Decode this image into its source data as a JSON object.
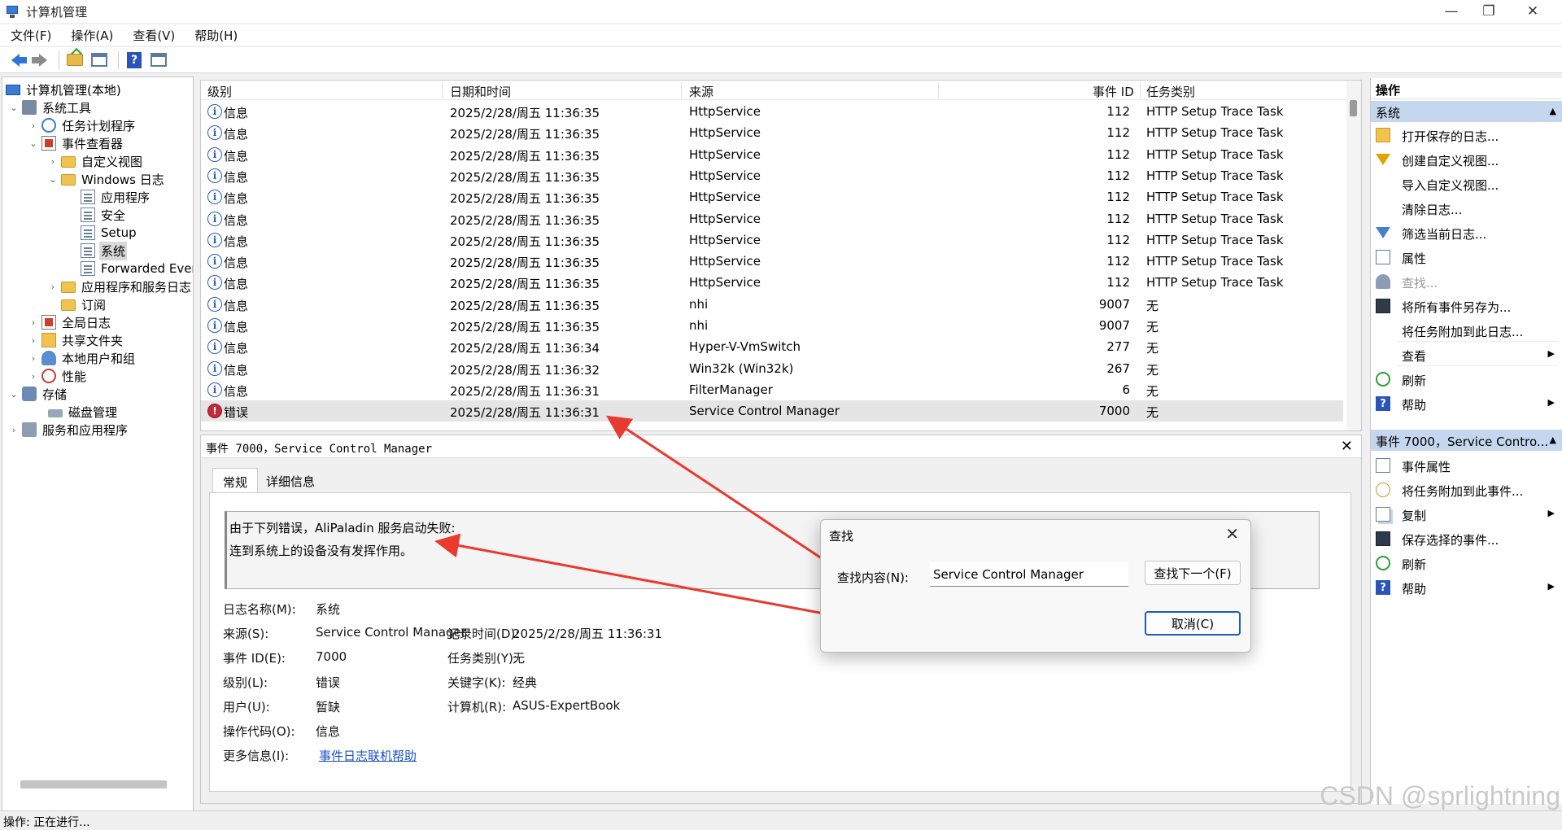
{
  "window": {
    "title": "计算机管理",
    "minimize": "—",
    "maximize": "❐",
    "close": "✕"
  },
  "menu": [
    "文件(F)",
    "操作(A)",
    "查看(V)",
    "帮助(H)"
  ],
  "tree": {
    "root": "计算机管理(本地)",
    "system_tools": "系统工具",
    "task_scheduler": "任务计划程序",
    "event_viewer": "事件查看器",
    "custom_views": "自定义视图",
    "windows_logs": "Windows 日志",
    "application": "应用程序",
    "security": "安全",
    "setup": "Setup",
    "system": "系统",
    "forwarded": "Forwarded Even",
    "app_service_logs": "应用程序和服务日志",
    "subscriptions": "订阅",
    "global_logs": "全局日志",
    "shared_folders": "共享文件夹",
    "local_users": "本地用户和组",
    "performance": "性能",
    "storage": "存储",
    "disk_mgmt": "磁盘管理",
    "services_apps": "服务和应用程序"
  },
  "events": {
    "columns": {
      "level": "级别",
      "datetime": "日期和时间",
      "source": "来源",
      "event_id": "事件 ID",
      "category": "任务类别"
    },
    "rows": [
      {
        "level": "信息",
        "datetime": "2025/2/28/周五 11:36:35",
        "source": "HttpService",
        "id": "112",
        "category": "HTTP Setup Trace Task"
      },
      {
        "level": "信息",
        "datetime": "2025/2/28/周五 11:36:35",
        "source": "HttpService",
        "id": "112",
        "category": "HTTP Setup Trace Task"
      },
      {
        "level": "信息",
        "datetime": "2025/2/28/周五 11:36:35",
        "source": "HttpService",
        "id": "112",
        "category": "HTTP Setup Trace Task"
      },
      {
        "level": "信息",
        "datetime": "2025/2/28/周五 11:36:35",
        "source": "HttpService",
        "id": "112",
        "category": "HTTP Setup Trace Task"
      },
      {
        "level": "信息",
        "datetime": "2025/2/28/周五 11:36:35",
        "source": "HttpService",
        "id": "112",
        "category": "HTTP Setup Trace Task"
      },
      {
        "level": "信息",
        "datetime": "2025/2/28/周五 11:36:35",
        "source": "HttpService",
        "id": "112",
        "category": "HTTP Setup Trace Task"
      },
      {
        "level": "信息",
        "datetime": "2025/2/28/周五 11:36:35",
        "source": "HttpService",
        "id": "112",
        "category": "HTTP Setup Trace Task"
      },
      {
        "level": "信息",
        "datetime": "2025/2/28/周五 11:36:35",
        "source": "HttpService",
        "id": "112",
        "category": "HTTP Setup Trace Task"
      },
      {
        "level": "信息",
        "datetime": "2025/2/28/周五 11:36:35",
        "source": "HttpService",
        "id": "112",
        "category": "HTTP Setup Trace Task"
      },
      {
        "level": "信息",
        "datetime": "2025/2/28/周五 11:36:35",
        "source": "nhi",
        "id": "9007",
        "category": "无"
      },
      {
        "level": "信息",
        "datetime": "2025/2/28/周五 11:36:35",
        "source": "nhi",
        "id": "9007",
        "category": "无"
      },
      {
        "level": "信息",
        "datetime": "2025/2/28/周五 11:36:34",
        "source": "Hyper-V-VmSwitch",
        "id": "277",
        "category": "无"
      },
      {
        "level": "信息",
        "datetime": "2025/2/28/周五 11:36:32",
        "source": "Win32k (Win32k)",
        "id": "267",
        "category": "无"
      },
      {
        "level": "信息",
        "datetime": "2025/2/28/周五 11:36:31",
        "source": "FilterManager",
        "id": "6",
        "category": "无"
      },
      {
        "level": "错误",
        "datetime": "2025/2/28/周五 11:36:31",
        "source": "Service Control Manager",
        "id": "7000",
        "category": "无"
      }
    ]
  },
  "detail": {
    "title": "事件 7000，Service Control Manager",
    "close": "✕",
    "tab_general": "常规",
    "tab_details": "详细信息",
    "message_line1": "由于下列错误，AliPaladin 服务启动失败:",
    "message_line2": "连到系统上的设备没有发挥作用。",
    "props": {
      "log_name_label": "日志名称(M):",
      "log_name": "系统",
      "source_label": "来源(S):",
      "source": "Service Control Manager",
      "logged_label": "记录时间(D):",
      "logged": "2025/2/28/周五 11:36:31",
      "event_id_label": "事件 ID(E):",
      "event_id": "7000",
      "task_label": "任务类别(Y):",
      "task": "无",
      "level_label": "级别(L):",
      "level": "错误",
      "keywords_label": "关键字(K):",
      "keywords": "经典",
      "user_label": "用户(U):",
      "user": "暂缺",
      "computer_label": "计算机(R):",
      "computer": "ASUS-ExpertBook",
      "opcode_label": "操作代码(O):",
      "opcode": "信息",
      "more_label": "更多信息(I):",
      "more_link": "事件日志联机帮助"
    }
  },
  "actions": {
    "title": "操作",
    "section_system": "系统",
    "system_items": [
      "打开保存的日志...",
      "创建自定义视图...",
      "导入自定义视图...",
      "清除日志...",
      "筛选当前日志...",
      "属性",
      "查找...",
      "将所有事件另存为...",
      "将任务附加到此日志...",
      "查看",
      "刷新",
      "帮助"
    ],
    "section_event": "事件 7000，Service Contro...",
    "event_items": [
      "事件属性",
      "将任务附加到此事件...",
      "复制",
      "保存选择的事件...",
      "刷新",
      "帮助"
    ]
  },
  "find_dialog": {
    "title": "查找",
    "close": "✕",
    "label": "查找内容(N):",
    "value": "Service Control Manager",
    "find_next": "查找下一个(F)",
    "cancel": "取消(C)"
  },
  "status": "操作: 正在进行...",
  "watermark": "CSDN @sprlightning",
  "colors": {
    "annotation_arrow": "#e83a2f",
    "section_header": "#c5d7ee",
    "error_icon": "#c42a3a",
    "link": "#1a4fc5"
  }
}
